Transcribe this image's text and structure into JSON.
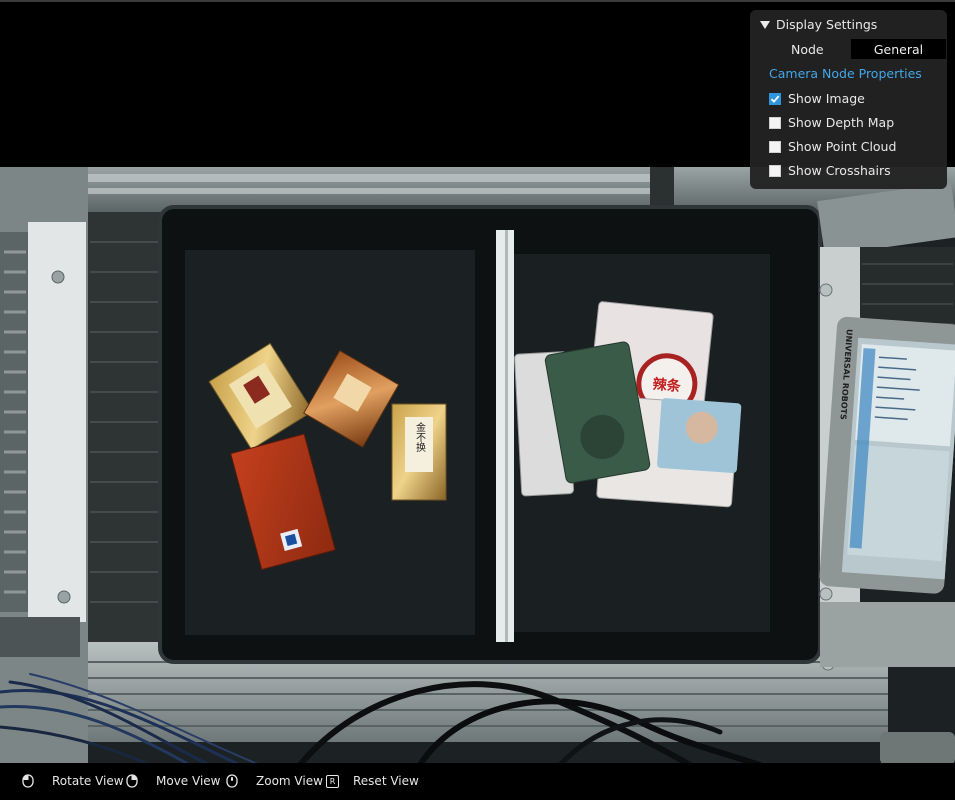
{
  "display_settings": {
    "title": "Display Settings",
    "node_label": "Node",
    "node_value": "General",
    "camera_properties_link": "Camera Node Properties",
    "options": [
      {
        "label": "Show Image",
        "checked": true
      },
      {
        "label": "Show Depth Map",
        "checked": false
      },
      {
        "label": "Show Point Cloud",
        "checked": false
      },
      {
        "label": "Show Crosshairs",
        "checked": false
      }
    ]
  },
  "controls": {
    "rotate": "Rotate View",
    "move": "Move View",
    "zoom": "Zoom View",
    "reset_key": "R",
    "reset": "Reset View"
  },
  "scene": {
    "tea_package_label": "金不换",
    "snack_package_label": "辣条",
    "device_brand": "UNIVERSAL ROBOTS"
  }
}
